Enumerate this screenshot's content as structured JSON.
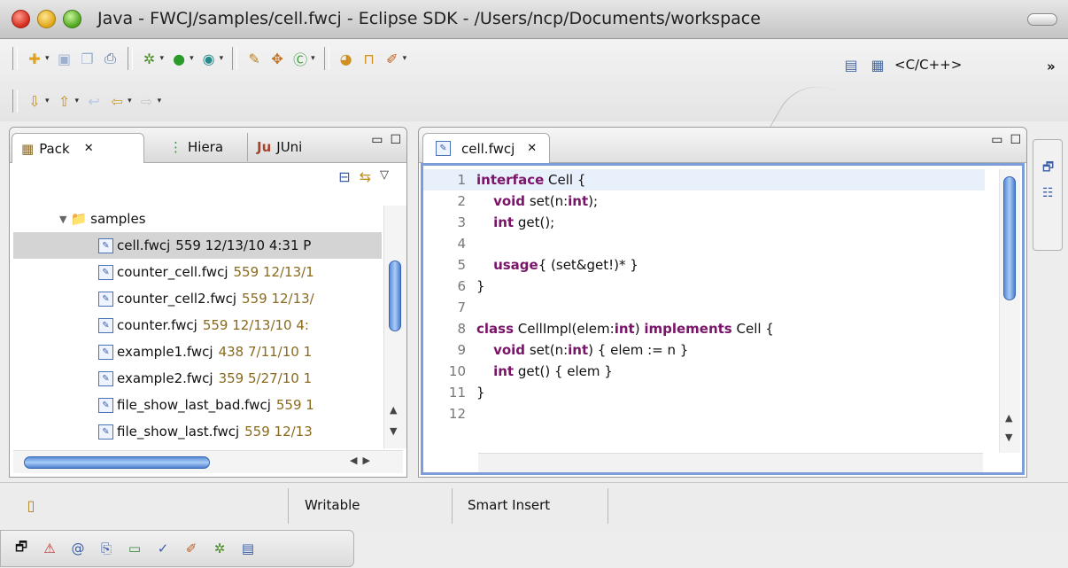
{
  "window": {
    "title": "Java - FWCJ/samples/cell.fwcj - Eclipse SDK - /Users/ncp/Documents/workspace"
  },
  "toolbar": {
    "perspective_label": "<C/C++>",
    "overflow_label": "»"
  },
  "left_view": {
    "tabs": [
      {
        "label": "Pack",
        "close": "✕"
      },
      {
        "label": "Hiera"
      },
      {
        "label": "JUni",
        "prefix": "Ju"
      }
    ],
    "folder": "samples",
    "files": [
      {
        "name": "cell.fwcj",
        "meta": "559  12/13/10 4:31 P",
        "selected": true
      },
      {
        "name": "counter_cell.fwcj",
        "meta": "559  12/13/1"
      },
      {
        "name": "counter_cell2.fwcj",
        "meta": "559  12/13/"
      },
      {
        "name": "counter.fwcj",
        "meta": "559  12/13/10 4:"
      },
      {
        "name": "example1.fwcj",
        "meta": "438  7/11/10 1"
      },
      {
        "name": "example2.fwcj",
        "meta": "359  5/27/10 1"
      },
      {
        "name": "file_show_last_bad.fwcj",
        "meta": "559  1"
      },
      {
        "name": "file_show_last.fwcj",
        "meta": "559  12/13"
      }
    ]
  },
  "editor": {
    "tab_label": "cell.fwcj",
    "tab_close": "✕",
    "lines": [
      {
        "num": "1",
        "text": "interface Cell {"
      },
      {
        "num": "2",
        "text": "    void set(n:int);"
      },
      {
        "num": "3",
        "text": "    int get();"
      },
      {
        "num": "4",
        "text": ""
      },
      {
        "num": "5",
        "text": "    usage{ (set&get!)* }"
      },
      {
        "num": "6",
        "text": "}"
      },
      {
        "num": "7",
        "text": ""
      },
      {
        "num": "8",
        "text": "class CellImpl(elem:int) implements Cell {"
      },
      {
        "num": "9",
        "text": "    void set(n:int) { elem := n }"
      },
      {
        "num": "10",
        "text": "    int get() { elem }"
      },
      {
        "num": "11",
        "text": "}"
      },
      {
        "num": "12",
        "text": ""
      }
    ]
  },
  "status": {
    "writable": "Writable",
    "insert_mode": "Smart Insert"
  }
}
